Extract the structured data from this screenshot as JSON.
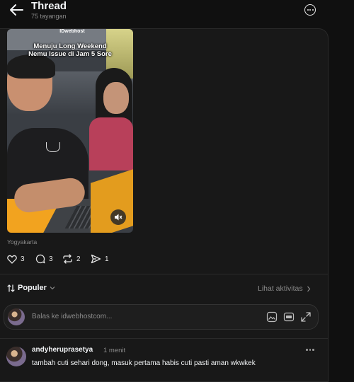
{
  "header": {
    "title": "Thread",
    "views": "75 tayangan"
  },
  "post": {
    "video": {
      "brand": "IDwebhost",
      "caption_line1": "Menuju Long Weekend",
      "caption_line2": "Nemu Issue di Jam 5 Sore"
    },
    "location": "Yogyakarta",
    "actions": {
      "likes": "3",
      "comments": "3",
      "reposts": "2",
      "shares": "1"
    }
  },
  "sort": {
    "label": "Populer",
    "activity_link": "Lihat aktivitas"
  },
  "reply_box": {
    "placeholder": "Balas ke idwebhostcom..."
  },
  "comment": {
    "username": "andyheruprasetya",
    "time": "1 menit",
    "text": "tambah cuti sehari dong, masuk pertama habis cuti pasti aman wkwkek"
  },
  "colors": {
    "background": "#101010",
    "panel": "#181818",
    "text": "#f3f5f7",
    "muted": "#8a8a8a"
  }
}
